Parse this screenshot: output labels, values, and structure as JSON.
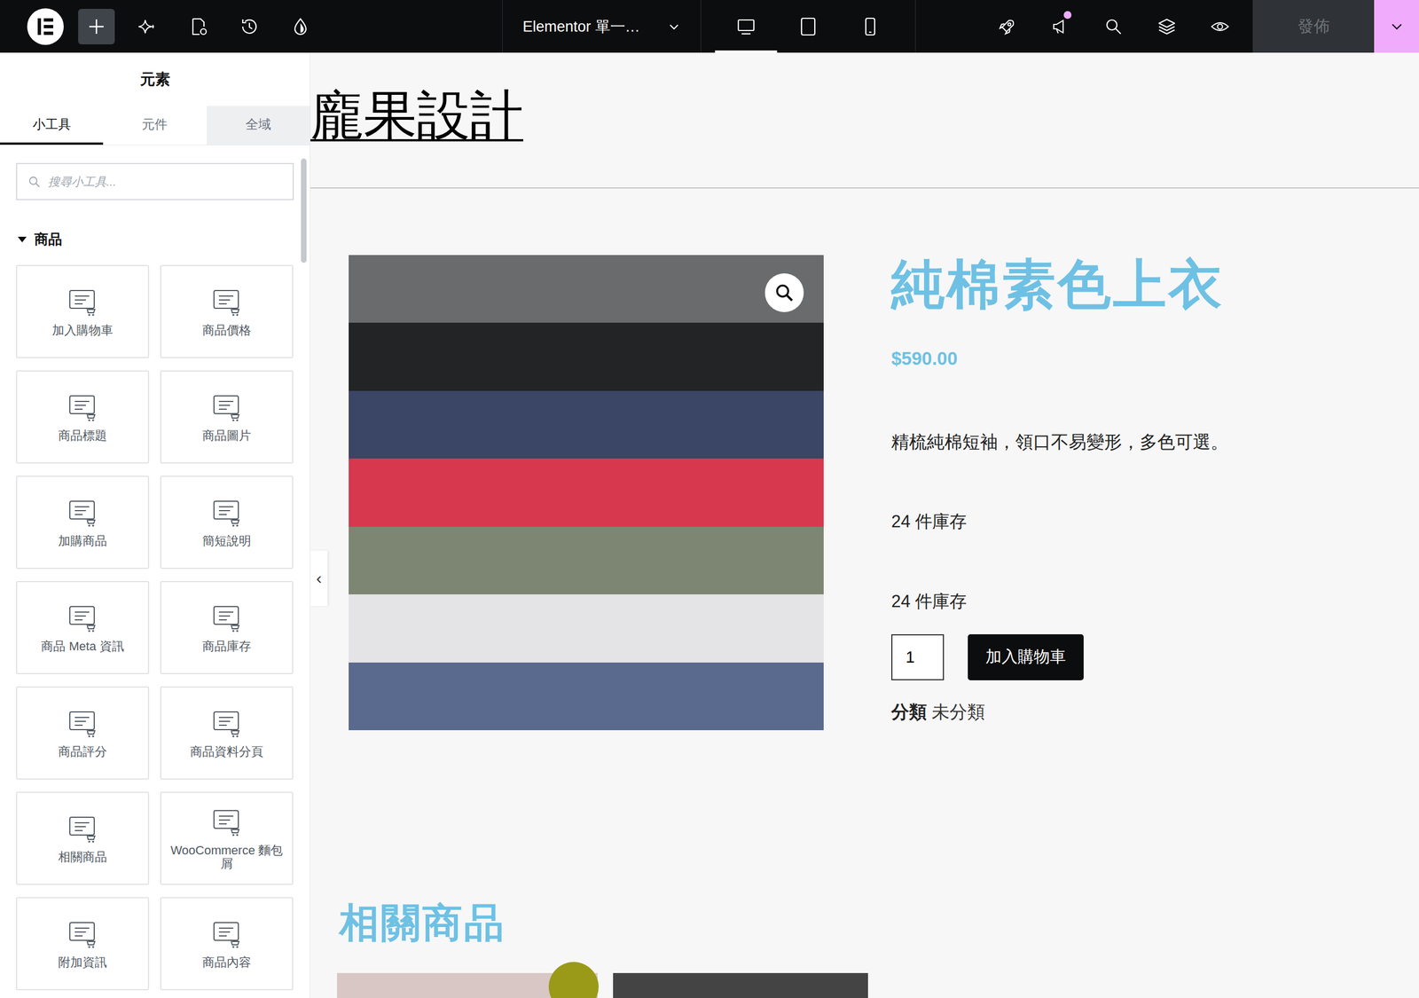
{
  "topbar": {
    "document_title": "Elementor 單一…",
    "devices": [
      {
        "name": "desktop",
        "selected": true
      },
      {
        "name": "tablet",
        "selected": false
      },
      {
        "name": "mobile",
        "selected": false
      }
    ],
    "publish": {
      "label": "發佈",
      "disabled": true
    },
    "notification_dot": true
  },
  "panel": {
    "title": "元素",
    "tabs": [
      {
        "label": "小工具",
        "selected": true,
        "hovered": false
      },
      {
        "label": "元件",
        "selected": false,
        "hovered": false
      },
      {
        "label": "全域",
        "selected": false,
        "hovered": true
      }
    ],
    "search": {
      "placeholder": "搜尋小工具..."
    },
    "category": {
      "name": "商品",
      "expanded": true
    },
    "widgets": [
      "加入購物車",
      "商品價格",
      "商品標題",
      "商品圖片",
      "加購商品",
      "簡短說明",
      "商品 Meta 資訊",
      "商品庫存",
      "商品評分",
      "商品資料分頁",
      "相關商品",
      "WooCommerce 麵包屑",
      "附加資訊",
      "商品內容"
    ],
    "collapse_handle": "‹"
  },
  "canvas": {
    "site_title": "龐果設計",
    "product": {
      "title": "純棉素色上衣",
      "price": "$590.00",
      "description": "精梳純棉短袖，領口不易變形，多色可選。",
      "stock": [
        "24 件庫存",
        "24 件庫存"
      ],
      "quantity": "1",
      "add_to_cart": "加入購物車",
      "meta_label": "分類",
      "meta_value": "未分類"
    },
    "related_heading": "相關商品"
  }
}
